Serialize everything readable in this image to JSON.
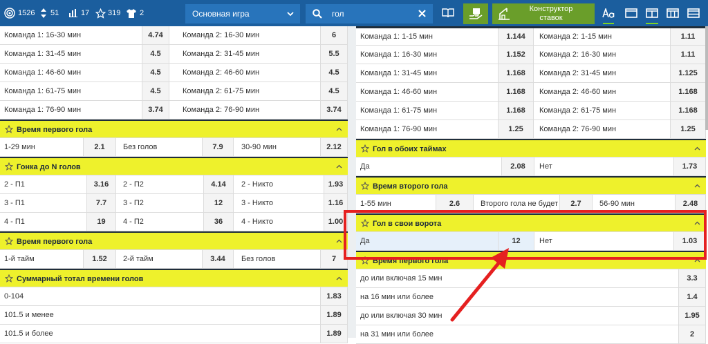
{
  "topbar": {
    "live_count": "1526",
    "sort_count": "51",
    "stats_count": "17",
    "fav_count": "319",
    "shirt_count": "2",
    "game_select": "Основная игра",
    "search_value": "гол",
    "constructor_line1": "Конструктор",
    "constructor_line2": "ставок"
  },
  "left": {
    "rows": [
      {
        "a": "Команда 1: 16-30 мин",
        "ao": "4.74",
        "b": "Команда 2: 16-30 мин",
        "bo": "6"
      },
      {
        "a": "Команда 1: 31-45 мин",
        "ao": "4.5",
        "b": "Команда 2: 31-45 мин",
        "bo": "5.5"
      },
      {
        "a": "Команда 1: 46-60 мин",
        "ao": "4.5",
        "b": "Команда 2: 46-60 мин",
        "bo": "4.5"
      },
      {
        "a": "Команда 1: 61-75 мин",
        "ao": "4.5",
        "b": "Команда 2: 61-75 мин",
        "bo": "4.5"
      },
      {
        "a": "Команда 1: 76-90 мин",
        "ao": "3.74",
        "b": "Команда 2: 76-90 мин",
        "bo": "3.74"
      }
    ],
    "first_goal": {
      "title": "Время первого гола",
      "cells": [
        {
          "l": "1-29 мин",
          "o": "2.1"
        },
        {
          "l": "Без голов",
          "o": "7.9"
        },
        {
          "l": "30-90 мин",
          "o": "2.12"
        }
      ]
    },
    "race": {
      "title": "Гонка до N голов",
      "rows": [
        [
          {
            "l": "2 - П1",
            "o": "3.16"
          },
          {
            "l": "2 - П2",
            "o": "4.14"
          },
          {
            "l": "2 - Никто",
            "o": "1.93"
          }
        ],
        [
          {
            "l": "3 - П1",
            "o": "7.7"
          },
          {
            "l": "3 - П2",
            "o": "12"
          },
          {
            "l": "3 - Никто",
            "o": "1.16"
          }
        ],
        [
          {
            "l": "4 - П1",
            "o": "19"
          },
          {
            "l": "4 - П2",
            "o": "36"
          },
          {
            "l": "4 - Никто",
            "o": "1.00"
          }
        ]
      ]
    },
    "first_goal2": {
      "title": "Время первого гола",
      "cells": [
        {
          "l": "1-й тайм",
          "o": "1.52"
        },
        {
          "l": "2-й тайм",
          "o": "3.44"
        },
        {
          "l": "Без голов",
          "o": "7"
        }
      ]
    },
    "total_time": {
      "title": "Суммарный тотал времени голов",
      "rows": [
        {
          "l": "0-104",
          "o": "1.83"
        },
        {
          "l": "101.5 и менее",
          "o": "1.89"
        },
        {
          "l": "101.5 и более",
          "o": "1.89"
        }
      ]
    }
  },
  "right": {
    "rows": [
      {
        "a": "Команда 1: 1-15 мин",
        "ao": "1.144",
        "b": "Команда 2: 1-15 мин",
        "bo": "1.11"
      },
      {
        "a": "Команда 1: 16-30 мин",
        "ao": "1.152",
        "b": "Команда 2: 16-30 мин",
        "bo": "1.11"
      },
      {
        "a": "Команда 1: 31-45 мин",
        "ao": "1.168",
        "b": "Команда 2: 31-45 мин",
        "bo": "1.125"
      },
      {
        "a": "Команда 1: 46-60 мин",
        "ao": "1.168",
        "b": "Команда 2: 46-60 мин",
        "bo": "1.168"
      },
      {
        "a": "Команда 1: 61-75 мин",
        "ao": "1.168",
        "b": "Команда 2: 61-75 мин",
        "bo": "1.168"
      },
      {
        "a": "Команда 1: 76-90 мин",
        "ao": "1.25",
        "b": "Команда 2: 76-90 мин",
        "bo": "1.25"
      }
    ],
    "both_halves": {
      "title": "Гол в обоих таймах",
      "a": "Да",
      "ao": "2.08",
      "b": "Нет",
      "bo": "1.73"
    },
    "second_goal": {
      "title": "Время второго гола",
      "cells": [
        {
          "l": "1-55 мин",
          "o": "2.6"
        },
        {
          "l": "Второго гола не будет",
          "o": "2.7"
        },
        {
          "l": "56-90 мин",
          "o": "2.48"
        }
      ]
    },
    "own_goal": {
      "title": "Гол в свои ворота",
      "a": "Да",
      "ao": "12",
      "b": "Нет",
      "bo": "1.03"
    },
    "first_goal": {
      "title": "Время первого гола",
      "rows": [
        {
          "l": "до или включая 15 мин",
          "o": "3.3"
        },
        {
          "l": "на 16 мин или более",
          "o": "1.4"
        },
        {
          "l": "до или включая 30 мин",
          "o": "1.95"
        },
        {
          "l": "на 31 мин или более",
          "o": "2"
        }
      ]
    }
  },
  "colors": {
    "topbar": "#1b5e9e",
    "header_bg": "#eef12c",
    "highlight": "#e52020",
    "accent_green": "#7ed321"
  }
}
